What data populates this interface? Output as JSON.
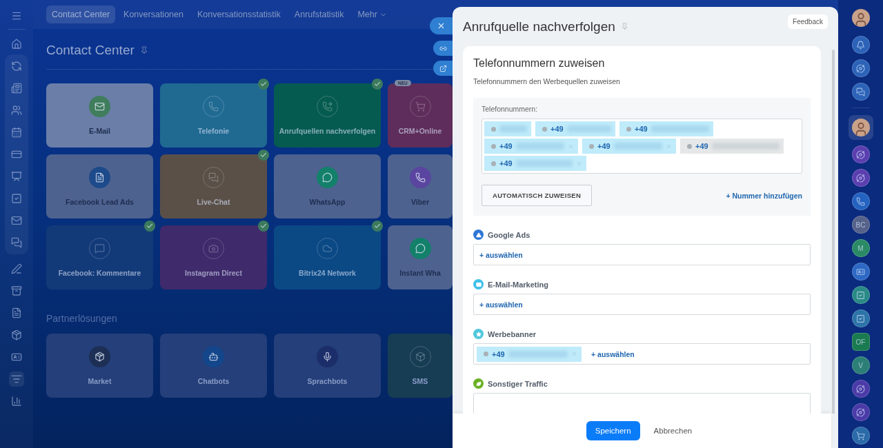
{
  "top_nav": {
    "tabs": [
      {
        "label": "Contact Center",
        "selected": true
      },
      {
        "label": "Konversationen",
        "selected": false
      },
      {
        "label": "Konversationsstatistik",
        "selected": false
      },
      {
        "label": "Anrufstatistik",
        "selected": false
      },
      {
        "label": "Mehr",
        "selected": false,
        "dropdown": true
      }
    ]
  },
  "page_title": "Contact Center",
  "cards": [
    {
      "label": "E-Mail",
      "kind": "available",
      "color": "#6a7ea8",
      "checked": false,
      "icon": {
        "color": "#3f7d5c"
      }
    },
    {
      "label": "Telefonie",
      "kind": "active",
      "color": "#206a92",
      "checked": true
    },
    {
      "label": "Anrufquellen nachverfolgen",
      "kind": "active",
      "color": "#065b50",
      "checked": true
    },
    {
      "label": "CRM+Online",
      "kind": "active",
      "color": "#5e2d5b",
      "checked": false,
      "badge": "NEU"
    },
    {
      "label": "Facebook Lead Ads",
      "kind": "available",
      "color": "#4e6290",
      "checked": false,
      "icon": {
        "color": "#1c4a8a"
      }
    },
    {
      "label": "Live-Chat",
      "kind": "active",
      "color": "#5a5048",
      "checked": true
    },
    {
      "label": "WhatsApp",
      "kind": "available",
      "color": "#4e6290",
      "checked": false,
      "icon": {
        "color": "#13806a"
      }
    },
    {
      "label": "Viber",
      "kind": "available",
      "color": "#4e6290",
      "checked": false,
      "icon": {
        "color": "#5a45a0"
      }
    },
    {
      "label": "Facebook: Kommentare",
      "kind": "active",
      "color": "#133a78",
      "checked": true
    },
    {
      "label": "Instagram Direct",
      "kind": "active",
      "color": "#3f2a6b",
      "checked": true
    },
    {
      "label": "Bitrix24 Network",
      "kind": "active",
      "color": "#0b4985",
      "checked": true
    },
    {
      "label": "Instant Wha",
      "kind": "available",
      "color": "#4e6290",
      "checked": false,
      "icon": {
        "color": "#13806a"
      }
    }
  ],
  "partner_title": "Partnerlösungen",
  "partner_cards": [
    {
      "label": "Market",
      "kind": "partner",
      "color": "#243f7a",
      "checked": false,
      "icon": {
        "color": "#1d2f55"
      }
    },
    {
      "label": "Chatbots",
      "kind": "partner",
      "color": "#243f7a",
      "checked": false,
      "icon": {
        "color": "#13468a"
      }
    },
    {
      "label": "Sprachbots",
      "kind": "partner",
      "color": "#243f7a",
      "checked": false,
      "icon": {
        "color": "#1c2e6a"
      }
    },
    {
      "label": "SMS",
      "kind": "partner",
      "color": "#173d55",
      "checked": false
    }
  ],
  "side_panel": {
    "title": "Anrufquelle nachverfolgen",
    "feedback": "Feedback",
    "section_title": "Telefonnummern zuweisen",
    "section_subtitle": "Telefonnummern den Werbequellen zuweisen",
    "numbers_label": "Telefonnummern:",
    "numbers": [
      {
        "removable": false,
        "disabled": false
      },
      {
        "text": "+49",
        "removable": false,
        "disabled": false
      },
      {
        "text": "+49",
        "removable": false,
        "disabled": false
      },
      {
        "text": "+49",
        "removable": true,
        "disabled": false
      },
      {
        "text": "+49",
        "removable": true,
        "disabled": false
      },
      {
        "text": "+49",
        "removable": false,
        "disabled": true
      },
      {
        "text": "+49",
        "removable": true,
        "disabled": false
      }
    ],
    "auto_button": "AUTOMATISCH ZUWEISEN",
    "add_number": "+ Nummer hinzufügen",
    "sources": [
      {
        "name": "Google Ads",
        "kind": "google",
        "color": "#2e77d6",
        "add_label": "+ auswählen"
      },
      {
        "name": "E-Mail-Marketing",
        "kind": "mail",
        "color": "#3ec0ea",
        "add_label": "+ auswählen"
      },
      {
        "name": "Werbebanner",
        "kind": "star",
        "color": "#4fc8dc",
        "add_label": "+ auswählen",
        "numbers": [
          {
            "text": "+49",
            "removable": true,
            "disabled": false
          }
        ]
      },
      {
        "name": "Sonstiger Traffic",
        "kind": "leaf",
        "color": "#6ab024"
      }
    ],
    "save": "Speichern",
    "cancel": "Abbrechen"
  },
  "right_rail": {
    "items": [
      {
        "kind": "avatar",
        "selected": false
      },
      {
        "kind": "bell",
        "color": "#2c63b8"
      },
      {
        "kind": "spiral",
        "color": "#2c63b8"
      },
      {
        "kind": "chat",
        "color": "#2c63b8"
      },
      {
        "kind": "avatar",
        "selected": true
      },
      {
        "kind": "spiral",
        "color": "#5b3fb0"
      },
      {
        "kind": "spiral",
        "color": "#5b3fb0"
      },
      {
        "kind": "phone",
        "color": "#2563c0"
      },
      {
        "kind": "initials",
        "text": "BC",
        "color": "#56628a"
      },
      {
        "kind": "initials",
        "text": "M",
        "color": "#2a8a66"
      },
      {
        "kind": "card",
        "color": "#2d68c4"
      },
      {
        "kind": "task",
        "color": "#2a8a86"
      },
      {
        "kind": "task",
        "color": "#2d74a8"
      },
      {
        "kind": "initials",
        "text": "OF",
        "color": "#1a7a50"
      },
      {
        "kind": "initials",
        "text": "V",
        "color": "#2c7f76"
      },
      {
        "kind": "spiral",
        "color": "#4b3aa8"
      },
      {
        "kind": "spiral",
        "color": "#4b3aa8"
      },
      {
        "kind": "cart",
        "color": "#2a6aa8"
      }
    ]
  }
}
